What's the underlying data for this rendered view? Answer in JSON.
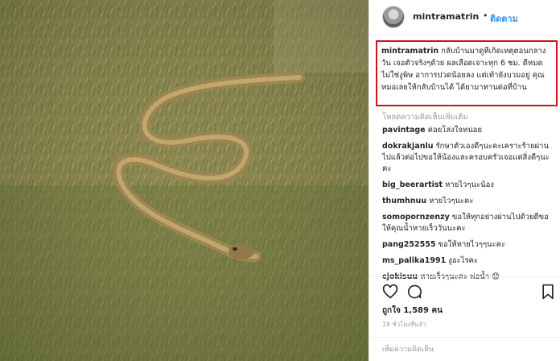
{
  "post": {
    "image_alt": "snake-on-grass-photo"
  },
  "header": {
    "username": "mintramatrin",
    "separator": "•",
    "follow_label": "ติดตาม"
  },
  "caption": {
    "username": "mintramatrin",
    "text": "กลับบ้านมาดูทีเกิดเหตุตอนกลางวัน เจอตัวจริงๆด้วย ผลเลือดเจาะทุก 6 ชม. ดีหมด ไม่ใช่งูพิษ อาการปวดน้อยลง แต่เท้ายังบวมอยู่ คุณหมอเลยให้กลับบ้านได้ ได้ยามาทานต่อที่บ้าน",
    "highlight_color": "#d0131b"
  },
  "load_more_label": "โหลดความคิดเห็นเพิ่มเติม",
  "comments": [
    {
      "username": "pavintage",
      "text": "ค่อยโล่งใจหน่อย"
    },
    {
      "username": "dokrakjanlu",
      "text": "รักษาตัวเองดีๆนะคะเคราะร้ายผ่านไปแล้วต่อไปขอให้น้องและครอบครัวเจอแต่สิ่งดีๆนะคะ"
    },
    {
      "username": "big_beerartist",
      "text": "หายไวๆนะน้อง"
    },
    {
      "username": "thumhnuu",
      "text": "หายไวๆนะคะ"
    },
    {
      "username": "somopornzenzy",
      "text": "ขอให้ทุกอย่างผ่านไปด้วยดีขอให้คุณน้ำหายเร็ววันนะคะ"
    },
    {
      "username": "pang252555",
      "text": "ขอให้หายไวๆๆนะคะ"
    },
    {
      "username": "ms_palika1991",
      "text": "งูอะไรคะ"
    },
    {
      "username": "cjokisuu",
      "text": "หายเร็วๆนะคะ พ่อน้ำ 😟"
    }
  ],
  "actions": {
    "like_icon": "heart-icon",
    "comment_icon": "comment-bubble-icon",
    "save_icon": "bookmark-icon"
  },
  "likes_text": "ถูกใจ 1,589 คน",
  "time_text": "19 ชั่วโมงที่แล้ว",
  "add_comment": {
    "placeholder": "เพิ่มความคิดเห็น"
  },
  "colors": {
    "link_blue": "#3897f0",
    "muted_gray": "#999999",
    "border": "#efefef"
  }
}
